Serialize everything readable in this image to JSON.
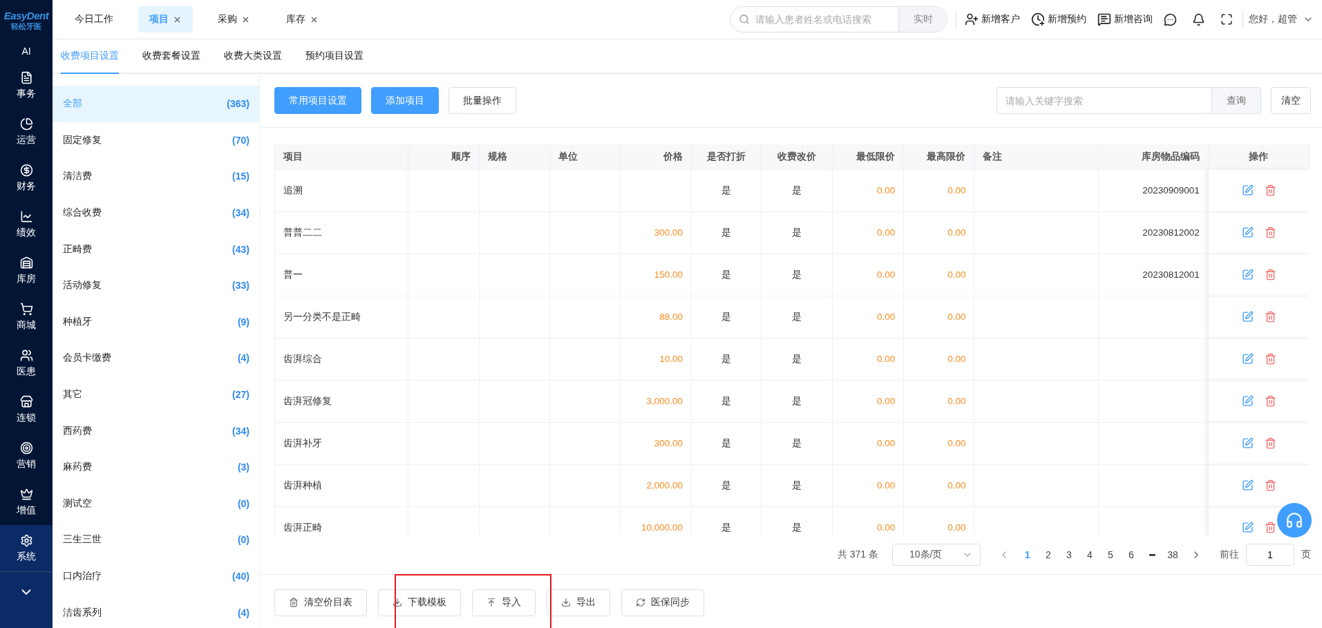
{
  "brand": {
    "name": "EasyDent",
    "subtitle": "轻松牙医"
  },
  "nav": {
    "ai": "AI",
    "items": [
      {
        "label": "事务",
        "selected": false
      },
      {
        "label": "运营",
        "selected": false
      },
      {
        "label": "财务",
        "selected": false
      },
      {
        "label": "绩效",
        "selected": false
      },
      {
        "label": "库房",
        "selected": false
      },
      {
        "label": "商城",
        "selected": false
      },
      {
        "label": "医患",
        "selected": false
      },
      {
        "label": "连锁",
        "selected": false
      },
      {
        "label": "营销",
        "selected": false
      },
      {
        "label": "增值",
        "selected": false
      },
      {
        "label": "系统",
        "selected": true
      }
    ]
  },
  "top_tabs": [
    {
      "label": "今日工作",
      "closable": false,
      "selected": false
    },
    {
      "label": "项目",
      "closable": true,
      "selected": true
    },
    {
      "label": "采购",
      "closable": true,
      "selected": false
    },
    {
      "label": "库存",
      "closable": true,
      "selected": false
    }
  ],
  "patient_search": {
    "placeholder": "请输入患者姓名或电话搜索",
    "mode": "实时"
  },
  "top_actions": [
    {
      "label": "新增客户"
    },
    {
      "label": "新增预约"
    },
    {
      "label": "新增咨询"
    }
  ],
  "user": {
    "greeting": "您好，超管"
  },
  "sub_tabs": [
    {
      "label": "收费项目设置",
      "selected": true
    },
    {
      "label": "收费套餐设置",
      "selected": false
    },
    {
      "label": "收费大类设置",
      "selected": false
    },
    {
      "label": "预约项目设置",
      "selected": false
    }
  ],
  "categories": [
    {
      "name": "全部",
      "count": "(363)",
      "selected": true
    },
    {
      "name": "固定修复",
      "count": "(70)",
      "selected": false
    },
    {
      "name": "清洁费",
      "count": "(15)",
      "selected": false
    },
    {
      "name": "综合收费",
      "count": "(34)",
      "selected": false
    },
    {
      "name": "正畸费",
      "count": "(43)",
      "selected": false
    },
    {
      "name": "活动修复",
      "count": "(33)",
      "selected": false
    },
    {
      "name": "种植牙",
      "count": "(9)",
      "selected": false
    },
    {
      "name": "会员卡缴费",
      "count": "(4)",
      "selected": false
    },
    {
      "name": "其它",
      "count": "(27)",
      "selected": false
    },
    {
      "name": "西药费",
      "count": "(34)",
      "selected": false
    },
    {
      "name": "麻药费",
      "count": "(3)",
      "selected": false
    },
    {
      "name": "测试空",
      "count": "(0)",
      "selected": false
    },
    {
      "name": "三生三世",
      "count": "(0)",
      "selected": false
    },
    {
      "name": "口内治疗",
      "count": "(40)",
      "selected": false
    },
    {
      "name": "洁齿系列",
      "count": "(4)",
      "selected": false
    }
  ],
  "toolbar": {
    "buttons": [
      {
        "label": "常用项目设置",
        "kind": "primary"
      },
      {
        "label": "添加项目",
        "kind": "primary"
      },
      {
        "label": "批量操作",
        "kind": "default"
      }
    ],
    "search": {
      "placeholder": "请输入关键字搜索",
      "button": "查询"
    },
    "clear": "清空"
  },
  "table": {
    "columns": [
      {
        "label": "项目"
      },
      {
        "label": "顺序"
      },
      {
        "label": "规格"
      },
      {
        "label": "单位"
      },
      {
        "label": "价格"
      },
      {
        "label": "是否打折"
      },
      {
        "label": "收费改价"
      },
      {
        "label": "最低限价"
      },
      {
        "label": "最高限价"
      },
      {
        "label": "备注"
      },
      {
        "label": "库房物品编码"
      },
      {
        "label": "操作"
      }
    ],
    "rows": [
      {
        "item": "追溯",
        "price": "",
        "discount": "是",
        "price_change": "是",
        "min": "0.00",
        "max": "0.00",
        "code": "20230909001"
      },
      {
        "item": "普普二二",
        "price": "300.00",
        "discount": "是",
        "price_change": "是",
        "min": "0.00",
        "max": "0.00",
        "code": "20230812002"
      },
      {
        "item": "普一",
        "price": "150.00",
        "discount": "是",
        "price_change": "是",
        "min": "0.00",
        "max": "0.00",
        "code": "20230812001"
      },
      {
        "item": "另一分类不是正畸",
        "price": "88.00",
        "discount": "是",
        "price_change": "是",
        "min": "0.00",
        "max": "0.00",
        "code": ""
      },
      {
        "item": "齿湃综合",
        "price": "10.00",
        "discount": "是",
        "price_change": "是",
        "min": "0.00",
        "max": "0.00",
        "code": ""
      },
      {
        "item": "齿湃冠修复",
        "price": "3,000.00",
        "discount": "是",
        "price_change": "是",
        "min": "0.00",
        "max": "0.00",
        "code": ""
      },
      {
        "item": "齿湃补牙",
        "price": "300.00",
        "discount": "是",
        "price_change": "是",
        "min": "0.00",
        "max": "0.00",
        "code": ""
      },
      {
        "item": "齿湃种植",
        "price": "2,000.00",
        "discount": "是",
        "price_change": "是",
        "min": "0.00",
        "max": "0.00",
        "code": ""
      },
      {
        "item": "齿湃正畸",
        "price": "10,000.00",
        "discount": "是",
        "price_change": "是",
        "min": "0.00",
        "max": "0.00",
        "code": ""
      }
    ]
  },
  "pagination": {
    "total": "共 371 条",
    "page_size": "10条/页",
    "pages": [
      {
        "label": "1",
        "kind": "page",
        "selected": true
      },
      {
        "label": "2",
        "kind": "page",
        "selected": false
      },
      {
        "label": "3",
        "kind": "page",
        "selected": false
      },
      {
        "label": "4",
        "kind": "page",
        "selected": false
      },
      {
        "label": "5",
        "kind": "page",
        "selected": false
      },
      {
        "label": "6",
        "kind": "page",
        "selected": false
      },
      {
        "label": "•••",
        "kind": "more",
        "selected": false
      },
      {
        "label": "38",
        "kind": "page",
        "selected": false
      }
    ],
    "goto": "前往",
    "goto_value": "1",
    "goto_suffix": "页"
  },
  "bottom_buttons": [
    {
      "label": "清空价目表"
    },
    {
      "label": "下载模板"
    },
    {
      "label": "导入"
    },
    {
      "label": "导出"
    },
    {
      "label": "医保同步"
    }
  ]
}
